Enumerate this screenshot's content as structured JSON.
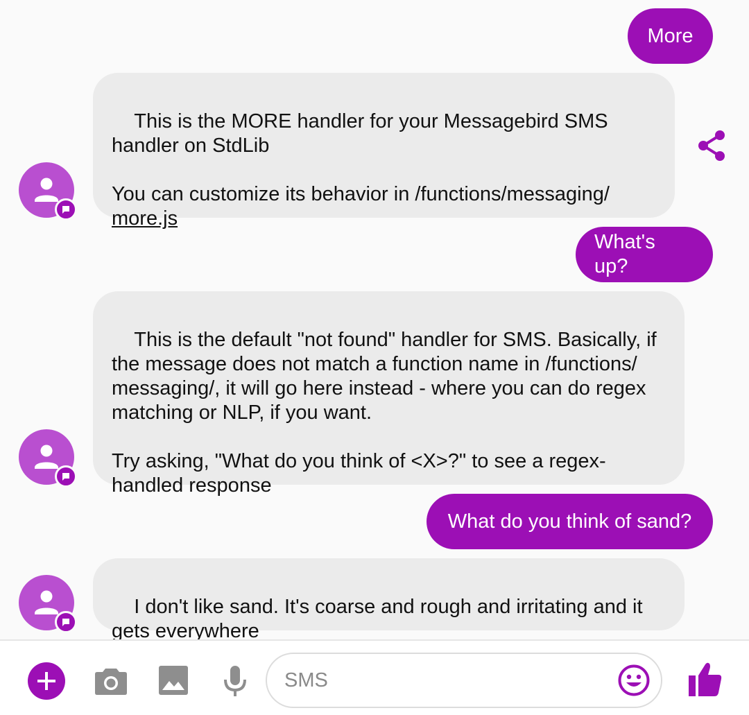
{
  "colors": {
    "accent": "#9c0fb5",
    "avatar": "#b94fd0",
    "incoming_bubble": "#ebebeb",
    "icon_gray": "#8e8e8e"
  },
  "messages": [
    {
      "direction": "outgoing",
      "text": "More"
    },
    {
      "direction": "incoming",
      "text": "This is the MORE handler for your Messagebird SMS\nhandler on StdLib\n\nYou can customize its behavior in /functions/messaging/",
      "link_text": "more.js"
    },
    {
      "direction": "outgoing",
      "text": "What's up?"
    },
    {
      "direction": "incoming",
      "text": "This is the default \"not found\" handler for SMS. Basically, if\nthe message does not match a function name in /functions/\nmessaging/, it will go here instead - where you can do regex\nmatching or NLP, if you want.\n\nTry asking, \"What do you think of <X>?\" to see a regex-\nhandled response"
    },
    {
      "direction": "outgoing",
      "text": "What do you think of sand?"
    },
    {
      "direction": "incoming",
      "text": "I don't like sand. It's coarse and rough and irritating and it\ngets everywhere"
    }
  ],
  "composer": {
    "placeholder": "SMS",
    "value": "",
    "icons": [
      "add-icon",
      "camera-icon",
      "gallery-icon",
      "microphone-icon",
      "emoji-icon",
      "thumbs-up-icon"
    ]
  },
  "thread_actions": {
    "share_icon": "share-icon"
  }
}
